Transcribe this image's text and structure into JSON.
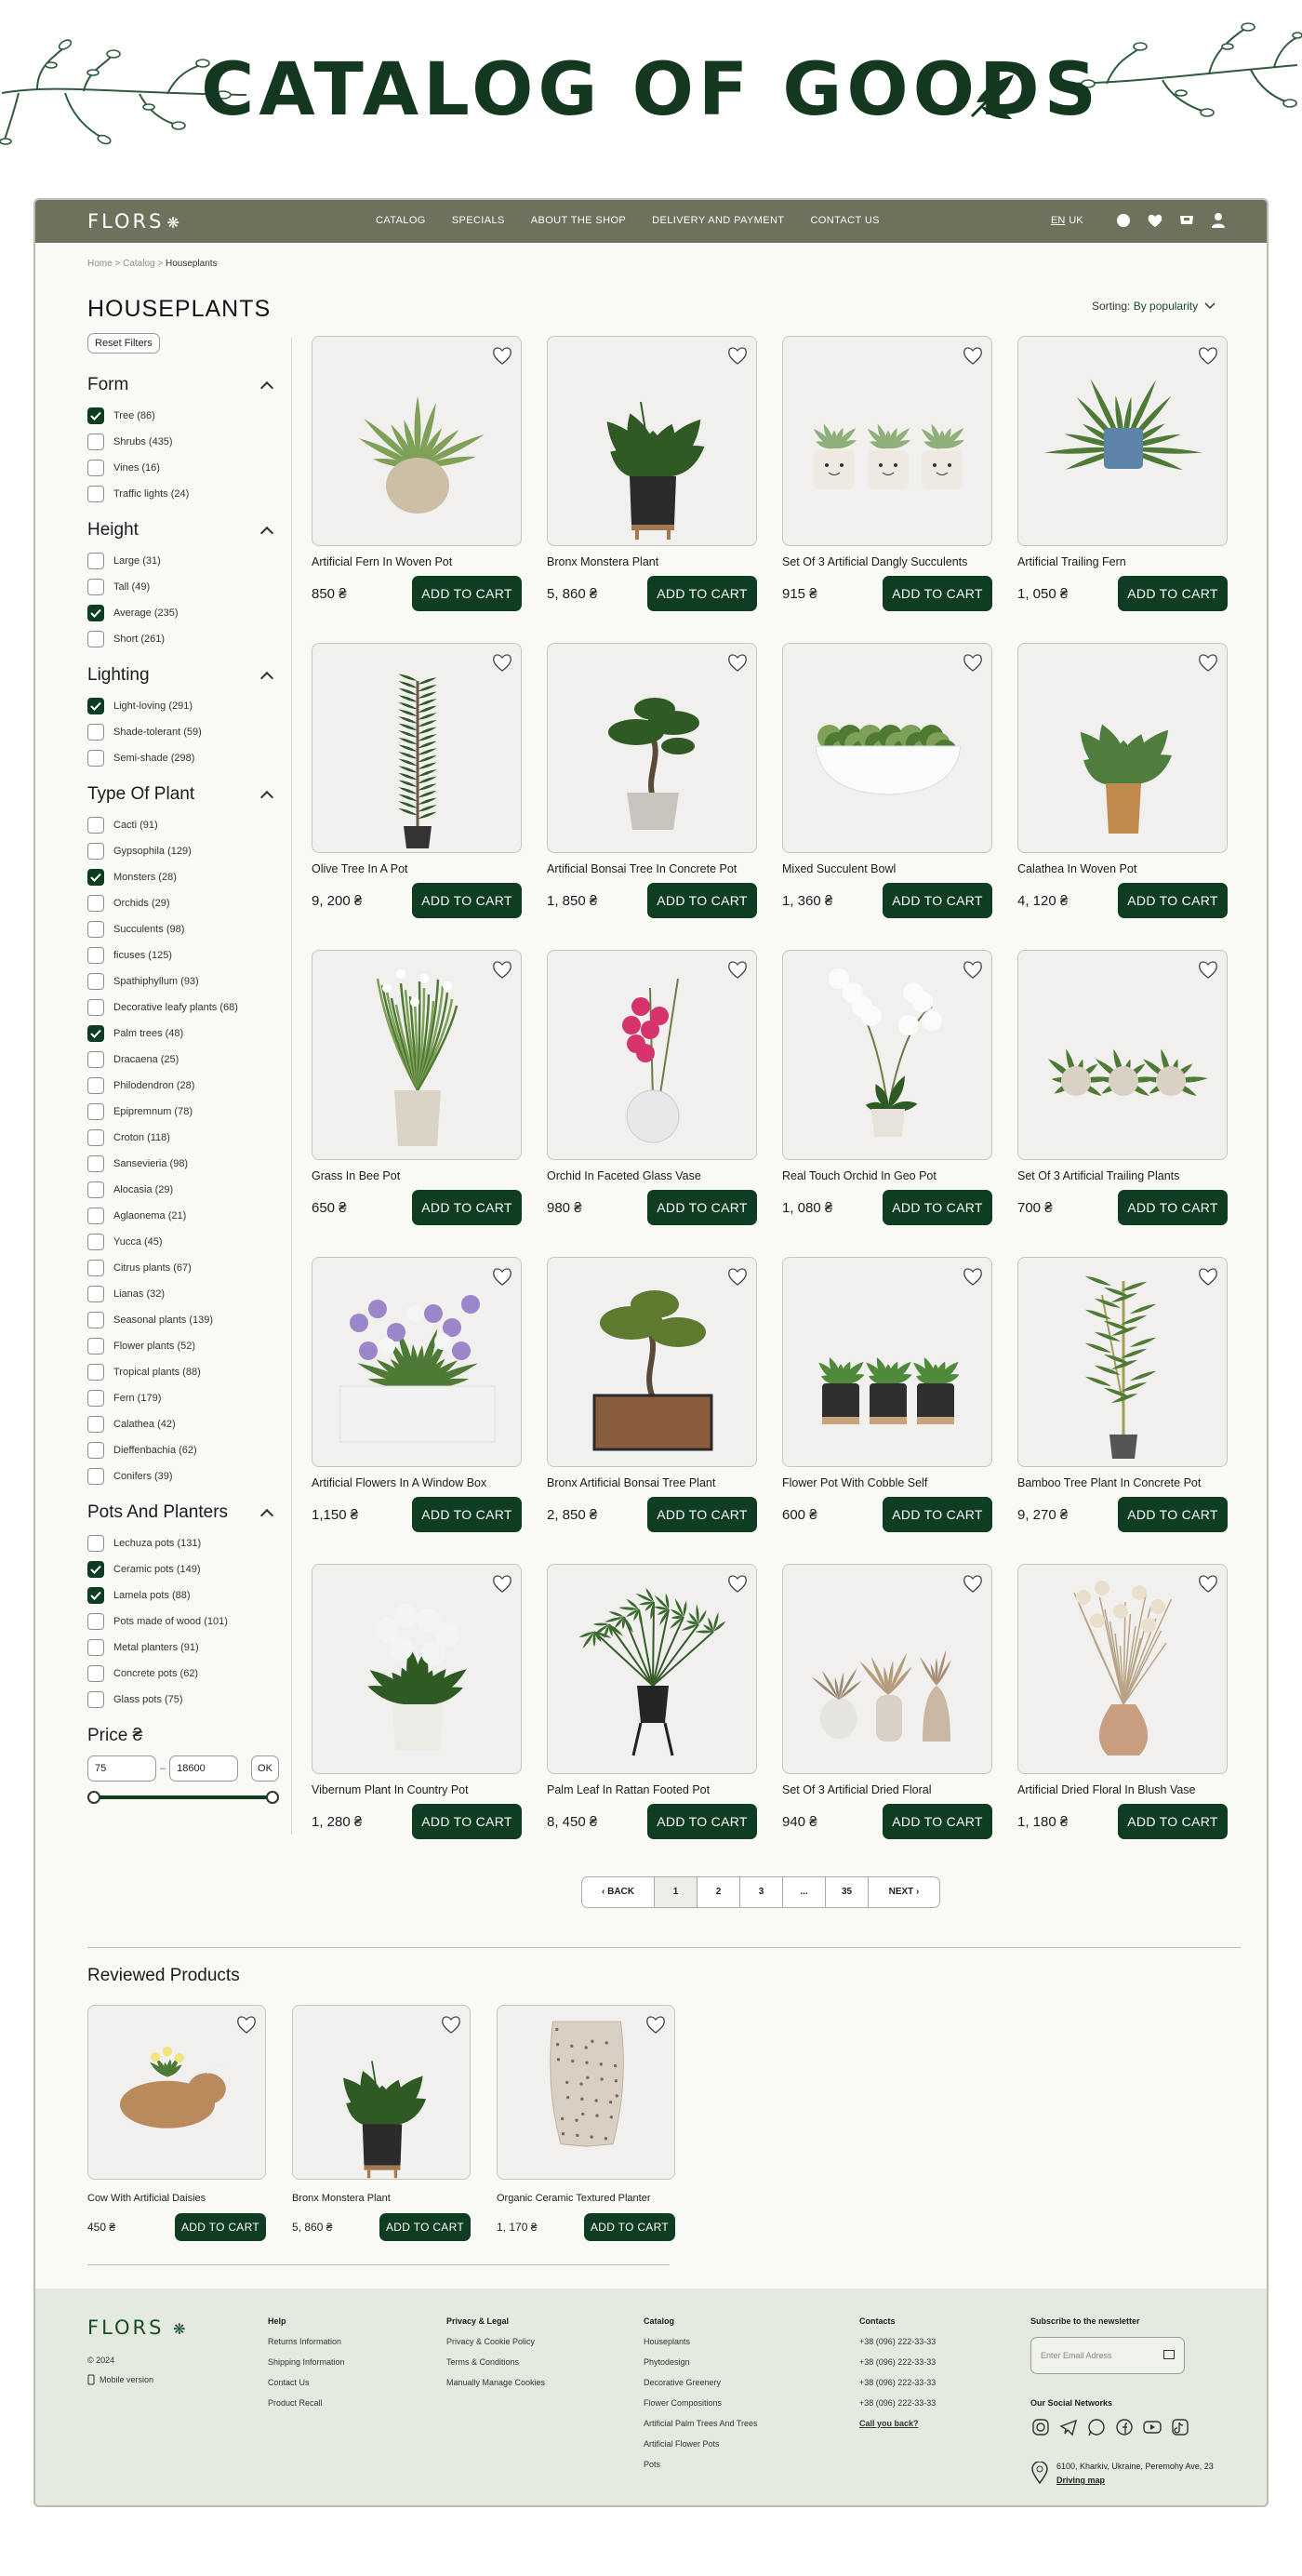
{
  "banner": {
    "title": "CATALOG OF GOODS"
  },
  "nav": {
    "logo": "FLORS",
    "links": [
      "CATALOG",
      "SPECIALS",
      "ABOUT THE SHOP",
      "DELIVERY AND PAYMENT",
      "CONTACT US"
    ],
    "lang_active": "EN",
    "lang_other": "UK",
    "icons": [
      "search-icon",
      "heart-icon",
      "cart-icon",
      "user-icon"
    ]
  },
  "breadcrumbs": {
    "home": "Home",
    "sep1": " > ",
    "catalog": "Catalog",
    "sep2": " > ",
    "current": "Houseplants"
  },
  "page_title": "HOUSEPLANTS",
  "sorting": {
    "label": "Sorting:",
    "value": "By popularity"
  },
  "reset_label": "Reset Filters",
  "filters": [
    {
      "title": "Form",
      "items": [
        {
          "label": "Tree (86)",
          "checked": true
        },
        {
          "label": "Shrubs (435)",
          "checked": false
        },
        {
          "label": "Vines (16)",
          "checked": false
        },
        {
          "label": "Traffic lights (24)",
          "checked": false
        }
      ]
    },
    {
      "title": "Height",
      "items": [
        {
          "label": "Large (31)",
          "checked": false
        },
        {
          "label": "Tall (49)",
          "checked": false
        },
        {
          "label": "Average (235)",
          "checked": true
        },
        {
          "label": "Short (261)",
          "checked": false
        }
      ]
    },
    {
      "title": "Lighting",
      "items": [
        {
          "label": "Light-loving (291)",
          "checked": true
        },
        {
          "label": "Shade-tolerant (59)",
          "checked": false
        },
        {
          "label": "Semi-shade (298)",
          "checked": false
        }
      ]
    },
    {
      "title": "Type Of Plant",
      "items": [
        {
          "label": "Cacti (91)",
          "checked": false
        },
        {
          "label": "Gypsophila (129)",
          "checked": false
        },
        {
          "label": "Monsters (28)",
          "checked": true
        },
        {
          "label": "Orchids (29)",
          "checked": false
        },
        {
          "label": "Succulents (98)",
          "checked": false
        },
        {
          "label": "ficuses (125)",
          "checked": false
        },
        {
          "label": "Spathiphyllum (93)",
          "checked": false
        },
        {
          "label": "Decorative leafy plants (68)",
          "checked": false
        },
        {
          "label": "Palm trees (48)",
          "checked": true
        },
        {
          "label": "Dracaena (25)",
          "checked": false
        },
        {
          "label": "Philodendron (28)",
          "checked": false
        },
        {
          "label": "Epipremnum (78)",
          "checked": false
        },
        {
          "label": "Croton (118)",
          "checked": false
        },
        {
          "label": "Sansevieria (98)",
          "checked": false
        },
        {
          "label": "Alocasia (29)",
          "checked": false
        },
        {
          "label": "Aglaonema (21)",
          "checked": false
        },
        {
          "label": "Yucca (45)",
          "checked": false
        },
        {
          "label": "Citrus plants (67)",
          "checked": false
        },
        {
          "label": "Lianas (32)",
          "checked": false
        },
        {
          "label": "Seasonal plants (139)",
          "checked": false
        },
        {
          "label": "Flower plants (52)",
          "checked": false
        },
        {
          "label": "Tropical plants (88)",
          "checked": false
        },
        {
          "label": "Fern (179)",
          "checked": false
        },
        {
          "label": "Calathea (42)",
          "checked": false
        },
        {
          "label": "Dieffenbachia (62)",
          "checked": false
        },
        {
          "label": "Conifers (39)",
          "checked": false
        }
      ]
    },
    {
      "title": "Pots And Planters",
      "items": [
        {
          "label": "Lechuza pots (131)",
          "checked": false
        },
        {
          "label": "Ceramic pots (149)",
          "checked": true
        },
        {
          "label": "Lamela pots (88)",
          "checked": true
        },
        {
          "label": "Pots made of wood (101)",
          "checked": false
        },
        {
          "label": "Metal planters (91)",
          "checked": false
        },
        {
          "label": "Concrete pots (62)",
          "checked": false
        },
        {
          "label": "Glass pots (75)",
          "checked": false
        }
      ]
    }
  ],
  "price_filter": {
    "title": "Price ₴",
    "min": "75",
    "dash": "–",
    "max": "18600",
    "ok": "OK"
  },
  "add_to_cart": "ADD TO CART",
  "products": [
    {
      "name": "Artificial Fern In Woven Pot",
      "price": "850 ₴",
      "icon": "fern"
    },
    {
      "name": "Bronx Monstera Plant",
      "price": "5, 860 ₴",
      "icon": "monstera"
    },
    {
      "name": "Set Of 3 Artificial Dangly Succulents",
      "price": "915 ₴",
      "icon": "succulent-trio"
    },
    {
      "name": "Artificial Trailing Fern",
      "price": "1, 050 ₴",
      "icon": "trailing-fern"
    },
    {
      "name": "Olive Tree In A Pot",
      "price": "9, 200 ₴",
      "icon": "olive"
    },
    {
      "name": "Artificial Bonsai Tree In Concrete Pot",
      "price": "1, 850 ₴",
      "icon": "bonsai"
    },
    {
      "name": "Mixed Succulent Bowl",
      "price": "1, 360 ₴",
      "icon": "bowl"
    },
    {
      "name": "Calathea In Woven Pot",
      "price": "4, 120 ₴",
      "icon": "calathea"
    },
    {
      "name": "Grass In Bee Pot",
      "price": "650 ₴",
      "icon": "grass"
    },
    {
      "name": "Orchid In Faceted Glass Vase",
      "price": "980 ₴",
      "icon": "orchid-pink"
    },
    {
      "name": "Real Touch Orchid In Geo Pot",
      "price": "1, 080 ₴",
      "icon": "orchid-white"
    },
    {
      "name": "Set Of 3 Artificial Trailing Plants",
      "price": "700 ₴",
      "icon": "trailing-trio"
    },
    {
      "name": "Artificial Flowers In A Window Box",
      "price": "1,150 ₴",
      "icon": "window-box"
    },
    {
      "name": "Bronx Artificial Bonsai Tree Plant",
      "price": "2, 850 ₴",
      "icon": "bonsai-box"
    },
    {
      "name": "Flower Pot With Cobble Self",
      "price": "600 ₴",
      "icon": "cobble-trio"
    },
    {
      "name": "Bamboo Tree Plant In Concrete Pot",
      "price": "9, 270 ₴",
      "icon": "bamboo"
    },
    {
      "name": "Vibernum Plant In Country Pot",
      "price": "1, 280 ₴",
      "icon": "viburnum"
    },
    {
      "name": "Palm Leaf In Rattan Footed Pot",
      "price": "8, 450 ₴",
      "icon": "palm"
    },
    {
      "name": "Set Of 3 Artificial Dried Floral",
      "price": "940 ₴",
      "icon": "dried-trio"
    },
    {
      "name": "Artificial Dried Floral In Blush Vase",
      "price": "1, 180 ₴",
      "icon": "dried-vase"
    }
  ],
  "pagination": {
    "back": "BACK",
    "pages": [
      "1",
      "2",
      "3",
      "...",
      "35"
    ],
    "current": "1",
    "next": "NEXT"
  },
  "reviewed": {
    "title": "Reviewed Products",
    "items": [
      {
        "name": "Cow With Artificial Daisies",
        "price": "450 ₴",
        "icon": "cow"
      },
      {
        "name": "Bronx Monstera Plant",
        "price": "5, 860 ₴",
        "icon": "monstera"
      },
      {
        "name": "Organic Ceramic Textured Planter",
        "price": "1, 170 ₴",
        "icon": "planter"
      }
    ]
  },
  "footer": {
    "logo": "FLORS",
    "year": "© 2024",
    "mobile": "Mobile version",
    "columns": [
      {
        "title": "Help",
        "items": [
          "Returns Information",
          "Shipping Information",
          "Contact Us",
          "Product Recall"
        ]
      },
      {
        "title": "Privacy & Legal",
        "items": [
          "Privacy & Cookie Policy",
          "Terms & Conditions",
          "Manually Manage Cookies"
        ]
      },
      {
        "title": "Catalog",
        "items": [
          "Houseplants",
          "Phytodesign",
          "Decorative Greenery",
          "Flower Compositions",
          "Artificial Palm Trees And Trees",
          "Artificial Flower Pots",
          "Pots"
        ]
      },
      {
        "title": "Contacts",
        "items": [
          "+38 (096) 222-33-33",
          "+38 (096) 222-33-33",
          "+38 (096) 222-33-33",
          "+38 (096) 222-33-33"
        ],
        "link": "Call you back?"
      }
    ],
    "newsletter_title": "Subscribe to the newsletter",
    "email_placeholder": "Enter Email Adress",
    "social_title": "Our Social Networks",
    "social_icons": [
      "instagram-icon",
      "telegram-icon",
      "whatsapp-icon",
      "facebook-icon",
      "youtube-icon",
      "tiktok-icon"
    ],
    "address": "6100, Kharkiv, Ukraine, Peremohy Ave, 23",
    "map_link": "Driving map"
  },
  "colors": {
    "brand_dark": "#0e3d22",
    "nav_bg": "#6c725b",
    "footer_bg": "#e5eadf",
    "page_bg": "#f9faf6"
  }
}
